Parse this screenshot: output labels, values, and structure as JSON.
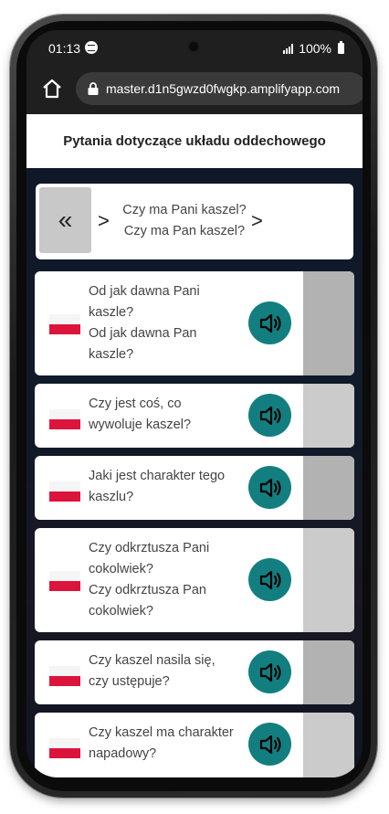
{
  "status": {
    "time": "01:13",
    "battery": "100%"
  },
  "browser": {
    "url": "master.d1n5gwzd0fwgkp.amplifyapp.com"
  },
  "page": {
    "title": "Pytania dotyczące układu oddechowego"
  },
  "nav": {
    "question_female": "Czy ma Pani kaszel?",
    "question_male": "Czy ma Pan kaszel?"
  },
  "questions": [
    {
      "lines": [
        "Od jak dawna Pani",
        "kaszle?",
        "Od jak dawna Pan",
        "kaszle?"
      ]
    },
    {
      "lines": [
        "Czy jest coś, co",
        "wywoluje kaszel?"
      ]
    },
    {
      "lines": [
        "Jaki jest charakter tego",
        "kaszlu?"
      ]
    },
    {
      "lines": [
        "Czy odkrztusza Pani",
        "cokolwiek?",
        "Czy odkrztusza Pan",
        "cokolwiek?"
      ]
    },
    {
      "lines": [
        "Czy kaszel nasila się,",
        "czy ustępuje?"
      ]
    },
    {
      "lines": [
        "Czy kaszel ma charakter",
        "napadowy?"
      ]
    }
  ],
  "colors": {
    "speaker": "#137e80",
    "flag_red": "#dc143c",
    "side_selected": "#b2b2b2",
    "side_default": "#cbcbcb"
  },
  "icons": {
    "home": "home-icon",
    "lock": "lock-icon",
    "back": "double-chevron-left-icon",
    "speaker": "speaker-icon",
    "flag": "poland-flag-icon"
  }
}
